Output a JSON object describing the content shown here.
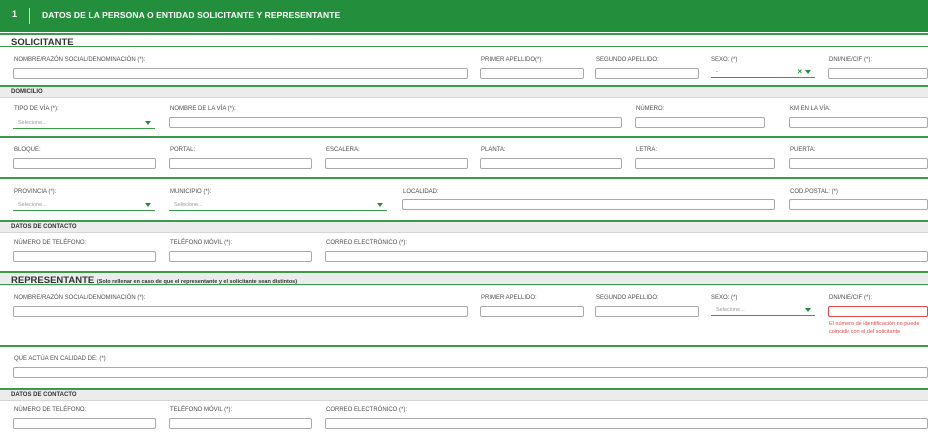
{
  "header": {
    "number": "1",
    "title": "DATOS DE LA PERSONA O ENTIDAD SOLICITANTE Y REPRESENTANTE"
  },
  "solicitante": {
    "section_title": "SOLICITANTE",
    "nombre_label": "NOMBRE/RAZÓN SOCIAL/DENOMINACIÓN (*):",
    "primer_apellido_label": "PRIMER APELLIDO(*):",
    "segundo_apellido_label": "SEGUNDO APELLIDO:",
    "sexo_label": "SEXO: (*)",
    "sexo_value": "-",
    "dni_label": "DNI/NIE/CIF (*):"
  },
  "domicilio": {
    "section_title": "DOMICILIO",
    "tipo_via_label": "TIPO DE VÍA (*):",
    "tipo_via_placeholder": "Selecione...",
    "nombre_via_label": "NOMBRE DE LA VÍA (*):",
    "numero_label": "NÚMERO:",
    "km_label": "KM EN LA VÍA:",
    "bloque_label": "BLOQUE:",
    "portal_label": "PORTAL:",
    "escalera_label": "ESCALERA:",
    "planta_label": "PLANTA:",
    "letra_label": "LETRA:",
    "puerta_label": "PUERTA:",
    "provincia_label": "PROVINCIA (*):",
    "provincia_placeholder": "Selecione...",
    "municipio_label": "MUNICIPIO (*):",
    "municipio_placeholder": "Selecione...",
    "localidad_label": "LOCALIDAD:",
    "cod_postal_label": "COD.POSTAL: (*)"
  },
  "contacto_solicitante": {
    "section_title": "DATOS DE CONTACTO",
    "telefono_label": "NÚMERO DE TELÉFONO:",
    "movil_label": "TELÉFONO MÓVIL (*):",
    "correo_label": "CORREO ELECTRÓNICO (*):"
  },
  "representante": {
    "section_title": "REPRESENTANTE",
    "section_note": "(Solo rellenar en caso de que el representante y el solicitante sean distintos)",
    "nombre_label": "NOMBRE/RAZÓN SOCIAL/DENOMINACIÓN (*):",
    "primer_apellido_label": "PRIMER APELLIDO:",
    "segundo_apellido_label": "SEGUNDO APELLIDO:",
    "sexo_label": "SEXO: (*)",
    "sexo_placeholder": "Selecione...",
    "dni_label": "DNI/NIE/CIF (*):",
    "dni_error": "El número de identificación no puede coincidir con el del solicitante",
    "calidad_label": "QUE ACTÚA EN CALIDAD DE: (*)"
  },
  "contacto_representante": {
    "section_title": "DATOS DE CONTACTO",
    "telefono_label": "NÚMERO DE TELÉFONO:",
    "movil_label": "TELÉFONO MÓVIL (*):",
    "correo_label": "CORREO ELECTRÓNICO (*):"
  },
  "colors": {
    "brand_green": "#238e3c",
    "error_red": "#e04b4b"
  }
}
